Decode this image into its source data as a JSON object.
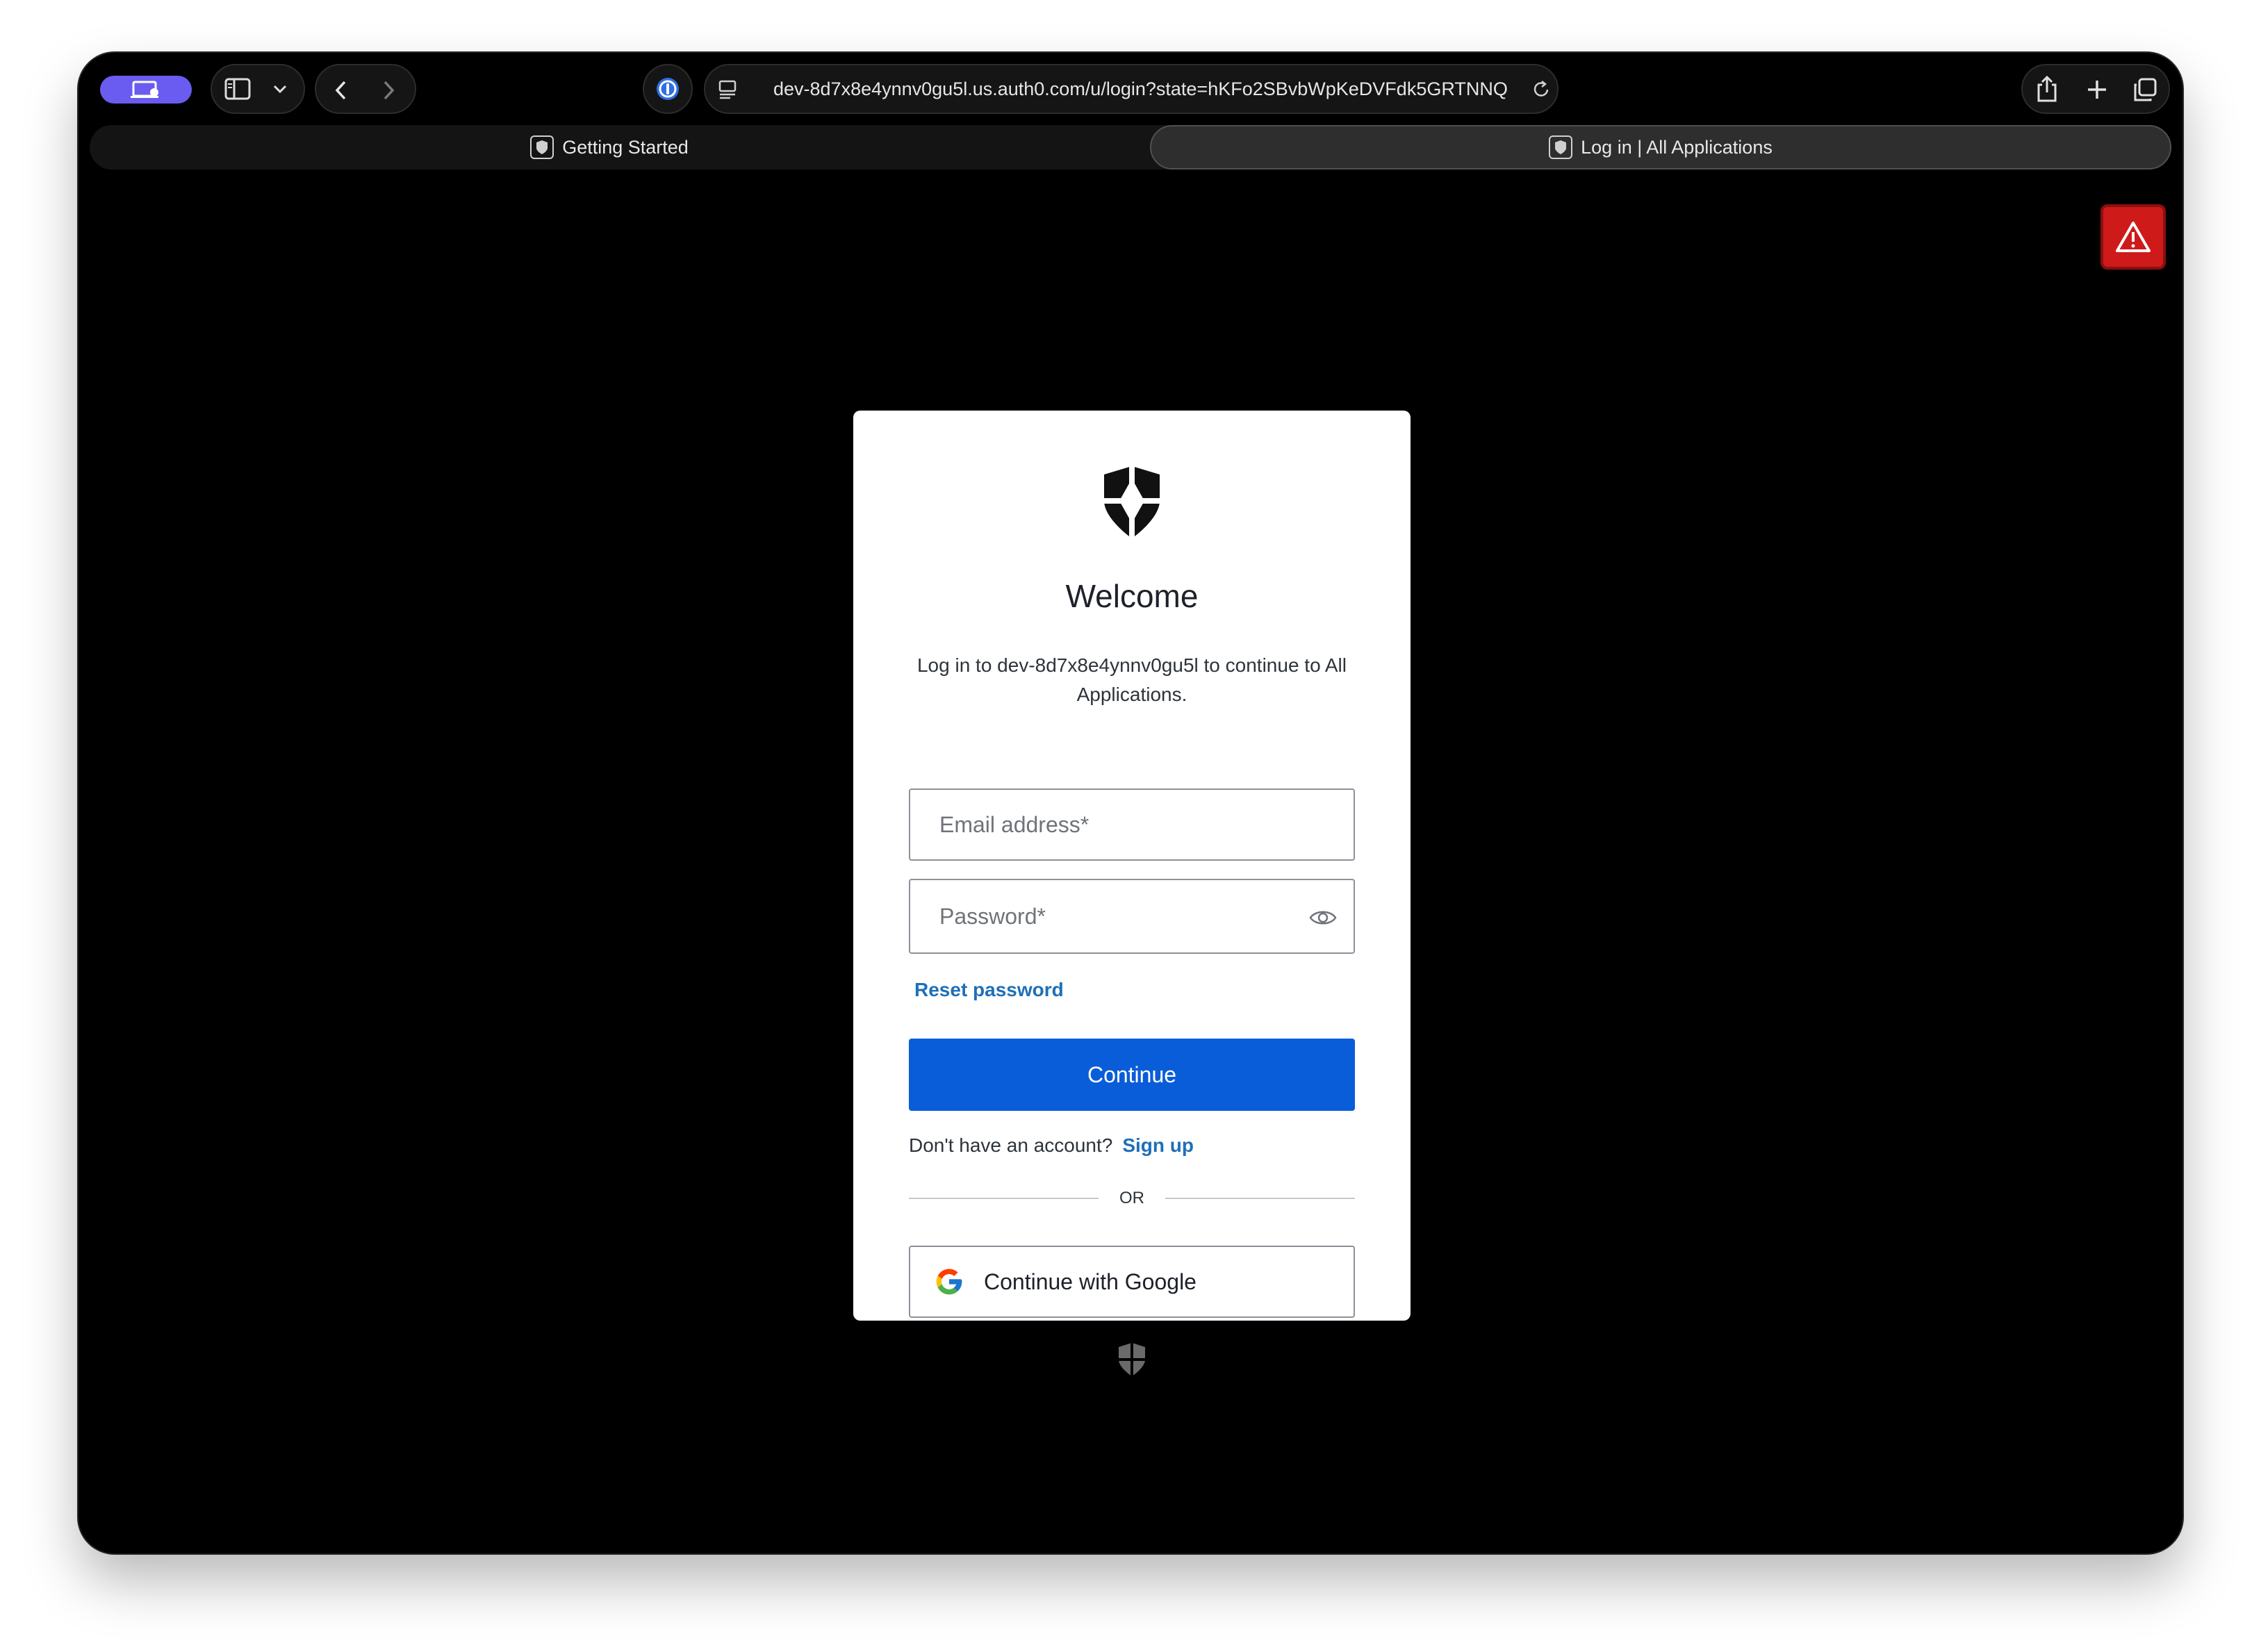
{
  "browser": {
    "url": "dev-8d7x8e4ynnv0gu5l.us.auth0.com/u/login?state=hKFo2SBvbWpKeDVFdk5GRTNNQ",
    "tabs": [
      {
        "label": "Getting Started",
        "active": false
      },
      {
        "label": "Log in | All Applications",
        "active": true
      }
    ],
    "icons": [
      "profile-icon",
      "sidebar-icon",
      "chevron-down-icon",
      "back-icon",
      "forward-icon",
      "password-manager-icon",
      "page-settings-icon",
      "reload-icon",
      "share-icon",
      "new-tab-icon",
      "tab-overview-icon",
      "warning-icon"
    ],
    "accent_color": "#6a5cf0"
  },
  "login": {
    "title": "Welcome",
    "subtitle": "Log in to dev-8d7x8e4ynnv0gu5l to continue to All Applications.",
    "email_placeholder": "Email address*",
    "password_placeholder": "Password*",
    "reset_password": "Reset password",
    "continue": "Continue",
    "no_account": "Don't have an account?",
    "sign_up": "Sign up",
    "or": "OR",
    "google": "Continue with Google",
    "primary_color": "#0a5dd8",
    "link_color": "#1f6fb7"
  },
  "alert": {
    "color": "#cf1a1a"
  }
}
